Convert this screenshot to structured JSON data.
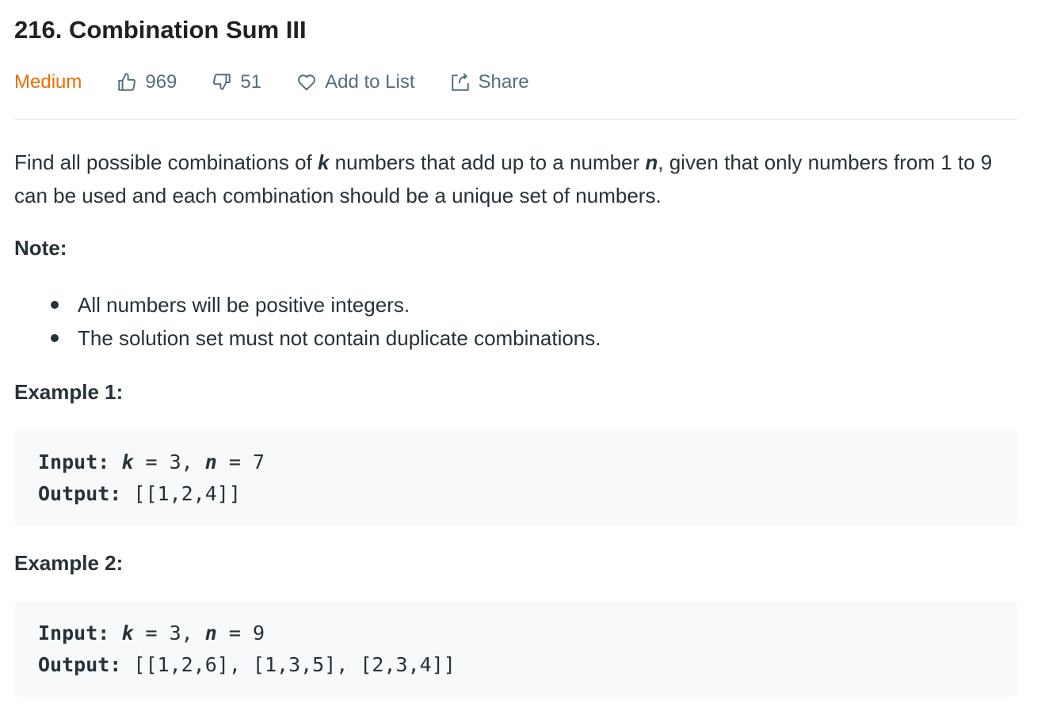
{
  "problem": {
    "title": "216. Combination Sum III",
    "difficulty": "Medium",
    "likes": "969",
    "dislikes": "51",
    "add_to_list_label": "Add to List",
    "share_label": "Share"
  },
  "colors": {
    "difficulty_medium": "#ef6c00",
    "meta_text": "#546e7a",
    "body_text": "#263238",
    "code_bg": "#f7f9fa"
  },
  "icons": {
    "like": "thumbs-up-icon",
    "dislike": "thumbs-down-icon",
    "add_to_list": "heart-icon",
    "share": "share-icon"
  },
  "description": {
    "part1": "Find all possible combinations of ",
    "var_k": "k",
    "part2": " numbers that add up to a number ",
    "var_n": "n",
    "part3": ", given that only numbers from 1 to 9 can be used and each combination should be a unique set of numbers."
  },
  "note": {
    "heading": "Note:",
    "items": [
      "All numbers will be positive integers.",
      "The solution set must not contain duplicate combinations."
    ]
  },
  "examples": [
    {
      "heading": "Example 1:",
      "input_label": "Input:",
      "k_var": "k",
      "k_eq": " = 3, ",
      "n_var": "n",
      "n_eq": " = 7",
      "output_label": "Output:",
      "output_value": " [[1,2,4]]"
    },
    {
      "heading": "Example 2:",
      "input_label": "Input:",
      "k_var": "k",
      "k_eq": " = 3, ",
      "n_var": "n",
      "n_eq": " = 9",
      "output_label": "Output:",
      "output_value": " [[1,2,6], [1,3,5], [2,3,4]]"
    }
  ]
}
